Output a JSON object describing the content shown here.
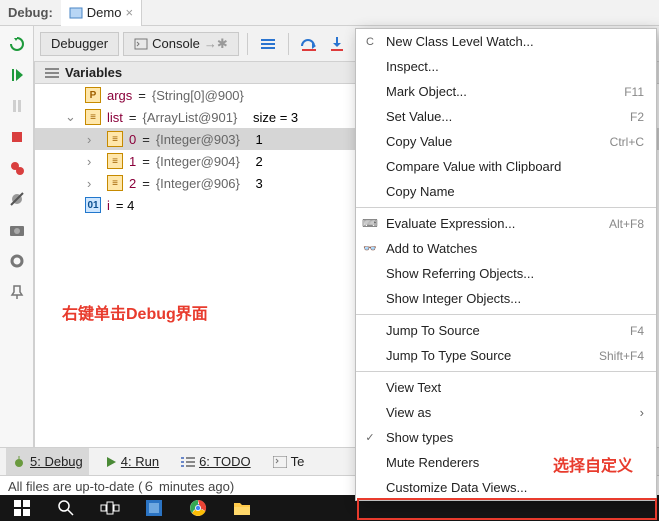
{
  "header": {
    "debug_label": "Debug:",
    "tab_title": "Demo",
    "close_x": "×"
  },
  "toolbar": {
    "debugger": "Debugger",
    "console": "Console",
    "right_arrow": "→✱"
  },
  "variables_header": "Variables",
  "vars": {
    "args": {
      "name": "args",
      "val": "{String[0]@900}"
    },
    "list": {
      "name": "list",
      "val": "{ArrayList@901}",
      "size": "size = 3"
    },
    "i0": {
      "idx": "0",
      "val": "{Integer@903}",
      "v": "1"
    },
    "i1": {
      "idx": "1",
      "val": "{Integer@904}",
      "v": "2"
    },
    "i2": {
      "idx": "2",
      "val": "{Integer@906}",
      "v": "3"
    },
    "ivar": {
      "name": "i",
      "eq": " = 4"
    }
  },
  "equals": " = ",
  "annotation_left": "右键单击Debug界面",
  "annotation_right": "选择自定义",
  "bottom_tabs": {
    "debug": "5: Debug",
    "run": "4: Run",
    "todo": "6: TODO",
    "terminal": "Te"
  },
  "status": "All files are up-to-date (６ minutes ago)",
  "context_menu": [
    {
      "label": "New Class Level Watch...",
      "icon": "C"
    },
    {
      "label": "Inspect..."
    },
    {
      "label": "Mark Object...",
      "shortcut": "F11"
    },
    {
      "label": "Set Value...",
      "shortcut": "F2"
    },
    {
      "label": "Copy Value",
      "shortcut": "Ctrl+C"
    },
    {
      "label": "Compare Value with Clipboard"
    },
    {
      "label": "Copy Name"
    },
    {
      "sep": true
    },
    {
      "label": "Evaluate Expression...",
      "shortcut": "Alt+F8",
      "icon": "⌨"
    },
    {
      "label": "Add to Watches",
      "icon": "👓"
    },
    {
      "label": "Show Referring Objects..."
    },
    {
      "label": "Show Integer Objects..."
    },
    {
      "sep": true
    },
    {
      "label": "Jump To Source",
      "shortcut": "F4"
    },
    {
      "label": "Jump To Type Source",
      "shortcut": "Shift+F4"
    },
    {
      "sep": true
    },
    {
      "label": "View Text"
    },
    {
      "label": "View as",
      "arrow": true
    },
    {
      "label": "Show types",
      "icon": "✓"
    },
    {
      "label": "Mute Renderers"
    },
    {
      "label": "Customize Data Views..."
    }
  ]
}
